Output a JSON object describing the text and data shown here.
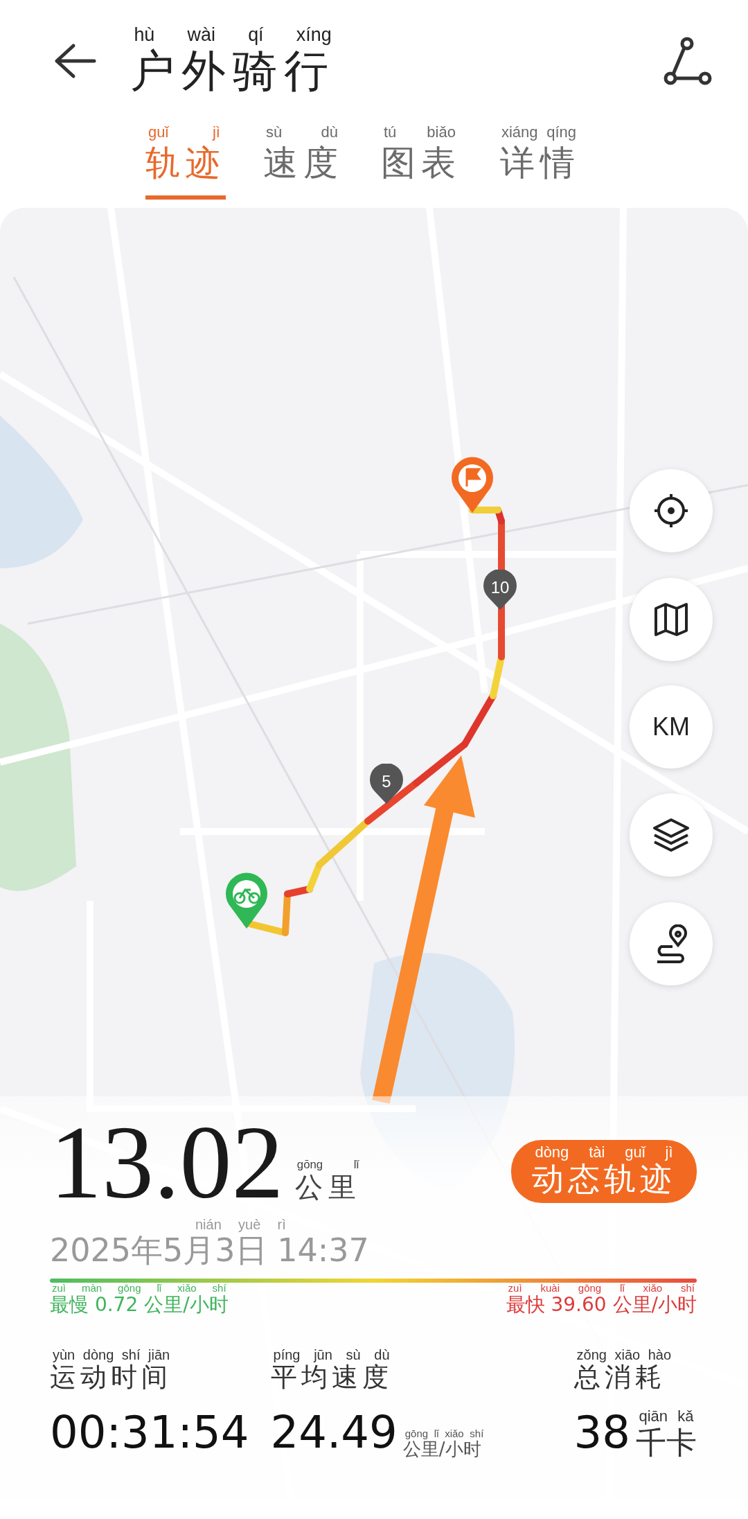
{
  "header": {
    "title": {
      "text": "户外骑行",
      "pinyin": "hù wài qí xíng"
    }
  },
  "tabs": [
    {
      "text": "轨迹",
      "pinyin": "guǐ jì",
      "selected": true
    },
    {
      "text": "速度",
      "pinyin": "sù dù",
      "selected": false
    },
    {
      "text": "图表",
      "pinyin": "tú biǎo",
      "selected": false
    },
    {
      "text": "详情",
      "pinyin": "xiáng qíng",
      "selected": false
    }
  ],
  "map": {
    "km_markers": [
      "5",
      "10"
    ],
    "tool_buttons": [
      {
        "kind": "locate"
      },
      {
        "kind": "map"
      },
      {
        "kind": "km",
        "label": "KM"
      },
      {
        "kind": "layers"
      },
      {
        "kind": "route"
      }
    ]
  },
  "summary": {
    "distance": "13.02",
    "distance_unit": {
      "text": "公里",
      "pinyin": "gōng lǐ"
    },
    "replay_button": {
      "text": "动态轨迹",
      "pinyin": "dòng tài guǐ jì"
    },
    "datetime": {
      "text": "2025年5月3日 14:37",
      "pinyin": "nián yuè rì"
    },
    "slowest": {
      "text": "最慢 0.72 公里/小时",
      "pinyin": "zuì màn gōng lǐ xiǎo shí"
    },
    "fastest": {
      "text": "最快 39.60 公里/小时",
      "pinyin": "zuì kuài gōng lǐ xiǎo shí"
    }
  },
  "stats": [
    {
      "label": {
        "text": "运动时间",
        "pinyin": "yùn dòng shí jiān"
      },
      "value": "00:31:54"
    },
    {
      "label": {
        "text": "平均速度",
        "pinyin": "píng jūn sù dù"
      },
      "value": "24.49",
      "unit": {
        "text": "公里/小时",
        "pinyin": "gōng lǐ xiǎo shí"
      }
    },
    {
      "label": {
        "text": "总消耗",
        "pinyin": "zǒng xiāo hào"
      },
      "value": "38",
      "unit": {
        "text": "千卡",
        "pinyin": "qiān kǎ"
      }
    }
  ]
}
